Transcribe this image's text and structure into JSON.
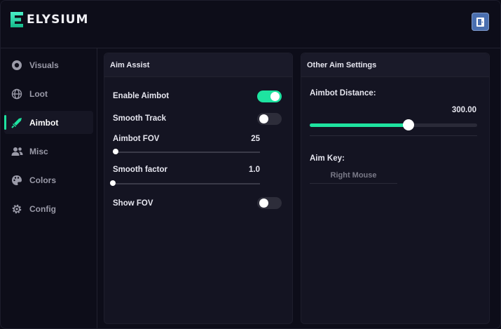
{
  "app": {
    "title": "ELYSIUM"
  },
  "colors": {
    "accent": "#1ee3a0",
    "exit_button": "#4a6fb0",
    "background": "#0d0d19",
    "panel": "#141422"
  },
  "sidebar": {
    "items": [
      {
        "label": "Visuals",
        "icon": "eye-circle-icon",
        "active": false
      },
      {
        "label": "Loot",
        "icon": "globe-icon",
        "active": false
      },
      {
        "label": "Aimbot",
        "icon": "sword-icon",
        "active": true
      },
      {
        "label": "Misc",
        "icon": "users-icon",
        "active": false
      },
      {
        "label": "Colors",
        "icon": "palette-icon",
        "active": false
      },
      {
        "label": "Config",
        "icon": "gear-icon",
        "active": false
      }
    ]
  },
  "aim_assist": {
    "title": "Aim Assist",
    "enable_aimbot": {
      "label": "Enable Aimbot",
      "on": true
    },
    "smooth_track": {
      "label": "Smooth Track",
      "on": false
    },
    "aimbot_fov": {
      "label": "Aimbot FOV",
      "value": "25",
      "fraction": 0.0
    },
    "smooth_factor": {
      "label": "Smooth factor",
      "value": "1.0",
      "fraction": 0.0
    },
    "show_fov": {
      "label": "Show FOV",
      "on": false
    }
  },
  "other_aim": {
    "title": "Other Aim Settings",
    "distance": {
      "label": "Aimbot Distance:",
      "value": "300.00",
      "fraction": 0.59
    },
    "aim_key": {
      "label": "Aim Key:",
      "value": "Right Mouse"
    }
  }
}
